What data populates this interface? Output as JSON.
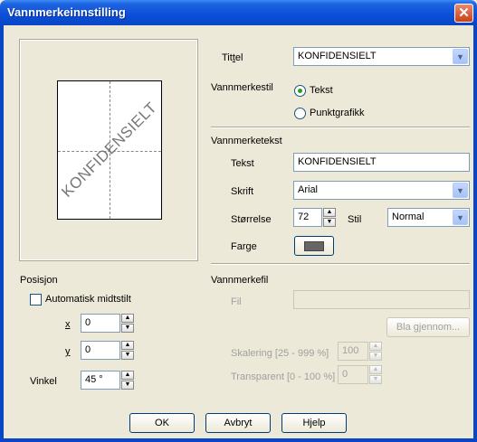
{
  "window": {
    "title": "Vannmerkeinnstilling",
    "close": "✕"
  },
  "preview": {
    "watermark": "KONFIDENSIELT"
  },
  "title_field": {
    "label": "Tittel",
    "value": "KONFIDENSIELT"
  },
  "style": {
    "label": "Vannmerkestil",
    "opt_text": "Tekst",
    "opt_bitmap": "Punktgrafikk",
    "selected": "text"
  },
  "watermark_text": {
    "heading": "Vannmerketekst",
    "text_label": "Tekst",
    "text_value": "KONFIDENSIELT",
    "font_label": "Skrift",
    "font_value": "Arial",
    "size_label": "Størrelse",
    "size_value": "72",
    "style_label": "Stil",
    "style_value": "Normal",
    "color_label": "Farge",
    "color_value": "#666666"
  },
  "position": {
    "heading": "Posisjon",
    "auto_center_label": "Automatisk midtstilt",
    "auto_center_checked": false,
    "x_label": "x",
    "x_value": "0",
    "y_label": "y",
    "y_value": "0",
    "angle_label": "Vinkel",
    "angle_value": "45 °"
  },
  "watermark_file": {
    "heading": "Vannmerkefil",
    "file_label": "Fil",
    "file_value": "",
    "browse_label": "Bla gjennom...",
    "scaling_label": "Skalering [25 - 999 %]",
    "scaling_value": "100",
    "transparent_label": "Transparent [0 - 100 %]",
    "transparent_value": "0"
  },
  "buttons": {
    "ok": "OK",
    "cancel": "Avbryt",
    "help": "Hjelp"
  },
  "icons": {
    "spin_up": "▲",
    "spin_down": "▼",
    "dropdown": "▼"
  }
}
